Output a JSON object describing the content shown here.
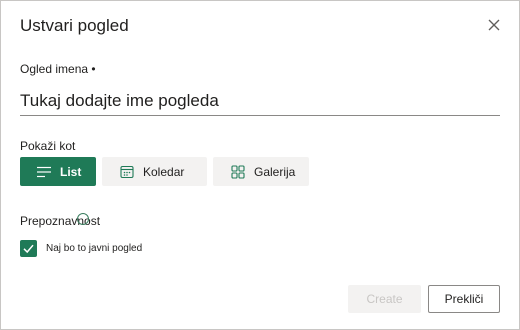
{
  "dialog": {
    "title": "Ustvari pogled",
    "close_icon": "close-icon"
  },
  "name_field": {
    "label": "Ogled imena •",
    "placeholder": "Tukaj dodajte ime pogleda",
    "value": ""
  },
  "show_as": {
    "label": "Pokaži kot",
    "options": [
      {
        "label": "List",
        "icon": "list-icon",
        "selected": true
      },
      {
        "label": "Koledar",
        "icon": "calendar-icon",
        "selected": false
      },
      {
        "label": "Galerija",
        "icon": "gallery-icon",
        "selected": false
      }
    ]
  },
  "visibility": {
    "label": "Prepoznavnost",
    "checkbox_label": "Naj bo to javni pogled",
    "checked": true
  },
  "footer": {
    "create_label": "Create",
    "cancel_label": "Prekliči"
  },
  "colors": {
    "accent": "#1f7a57",
    "neutral_button": "#f3f2f1",
    "border": "#8a8886"
  }
}
